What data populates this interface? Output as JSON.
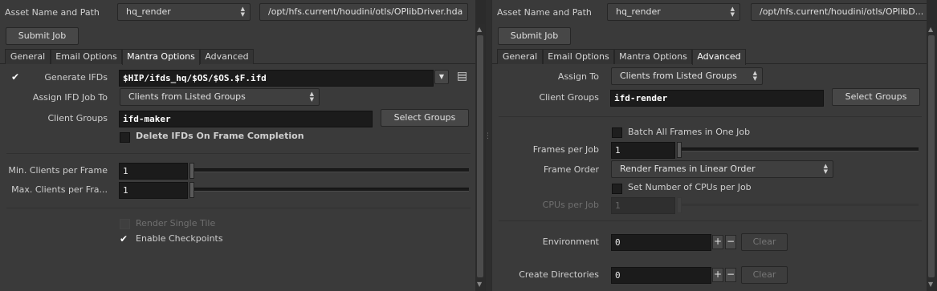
{
  "left": {
    "asset_label": "Asset Name and Path",
    "asset_name": "hq_render",
    "asset_path": "/opt/hfs.current/houdini/otls/OPlibDriver.hda",
    "submit_label": "Submit Job",
    "tabs": [
      "General",
      "Email Options",
      "Mantra Options",
      "Advanced"
    ],
    "active_tab": "Mantra Options",
    "generate_ifds_label": "Generate IFDs",
    "generate_ifds_value": "$HIP/ifds_hq/$OS/$OS.$F.ifd",
    "assign_ifd_label": "Assign IFD Job To",
    "assign_ifd_value": "Clients from Listed Groups",
    "client_groups_label": "Client Groups",
    "client_groups_value": "ifd-maker",
    "select_groups_label": "Select Groups",
    "delete_ifds_label": "Delete IFDs On Frame Completion",
    "min_clients_label": "Min. Clients per Frame",
    "min_clients_value": "1",
    "max_clients_label": "Max. Clients per Fra...",
    "max_clients_value": "1",
    "render_single_tile_label": "Render Single Tile",
    "enable_checkpoints_label": "Enable Checkpoints"
  },
  "right": {
    "asset_label": "Asset Name and Path",
    "asset_name": "hq_render",
    "asset_path": "/opt/hfs.current/houdini/otls/OPlibD...",
    "submit_label": "Submit Job",
    "tabs": [
      "General",
      "Email Options",
      "Mantra Options",
      "Advanced"
    ],
    "active_tab": "Advanced",
    "assign_to_label": "Assign To",
    "assign_to_value": "Clients from Listed Groups",
    "client_groups_label": "Client Groups",
    "client_groups_value": "ifd-render",
    "select_groups_label": "Select Groups",
    "batch_all_label": "Batch All Frames in One Job",
    "frames_per_job_label": "Frames per Job",
    "frames_per_job_value": "1",
    "frame_order_label": "Frame Order",
    "frame_order_value": "Render Frames in Linear Order",
    "set_cpus_label": "Set Number of CPUs per Job",
    "cpus_per_job_label": "CPUs per Job",
    "cpus_per_job_value": "1",
    "environment_label": "Environment",
    "environment_value": "0",
    "create_dirs_label": "Create Directories",
    "create_dirs_value": "0",
    "plus": "+",
    "minus": "−",
    "clear_label": "Clear"
  },
  "icons": {
    "updown": "▲▼",
    "dropdown": "▼",
    "check": "✔",
    "file": "▤",
    "scroll_up": "▲",
    "scroll_down": "▼",
    "grip": "⋮⋮"
  }
}
